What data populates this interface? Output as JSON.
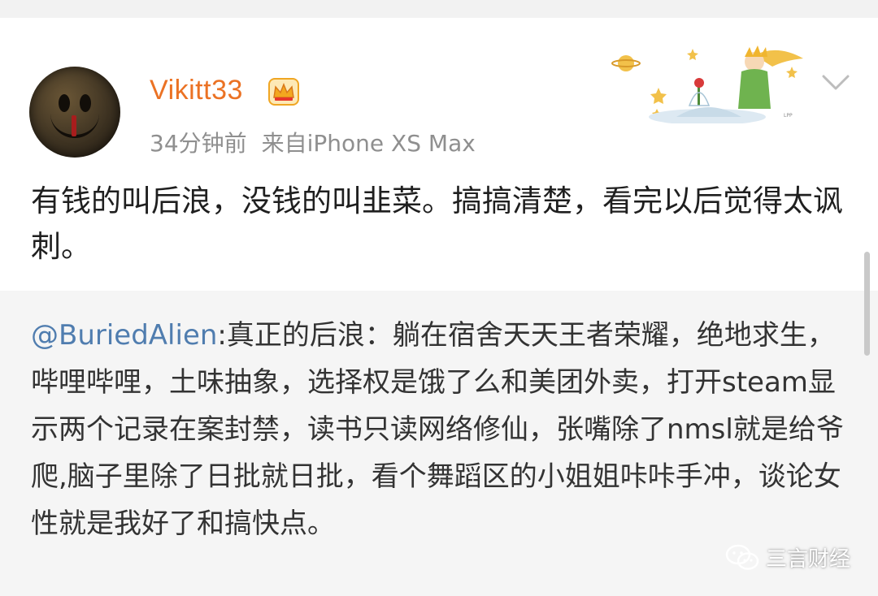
{
  "post": {
    "username": "Vikitt33",
    "time": "34分钟前",
    "source": "来自iPhone XS Max",
    "text": "有钱的叫后浪，没钱的叫韭菜。搞搞清楚，看完以后觉得太讽刺。",
    "icons": {
      "vip": "crown-vip-icon",
      "more": "chevron-down-icon"
    }
  },
  "repost": {
    "mention": "@BuriedAlien",
    "text": ":真正的后浪：躺在宿舍天天王者荣耀，绝地求生，哔哩哔哩，土味抽象，选择权是饿了么和美团外卖，打开steam显示两个记录在案封禁，读书只读网络修仙，张嘴除了nmsl就是给爷爬,脑子里除了日批就日批，看个舞蹈区的小姐姐咔咔手冲，谈论女性就是我好了和搞快点。"
  },
  "watermark": {
    "text": "三言财经",
    "icon": "wechat-icon"
  },
  "colors": {
    "username": "#eb7224",
    "mention": "#507daf",
    "repost_bg": "#f5f5f5"
  }
}
